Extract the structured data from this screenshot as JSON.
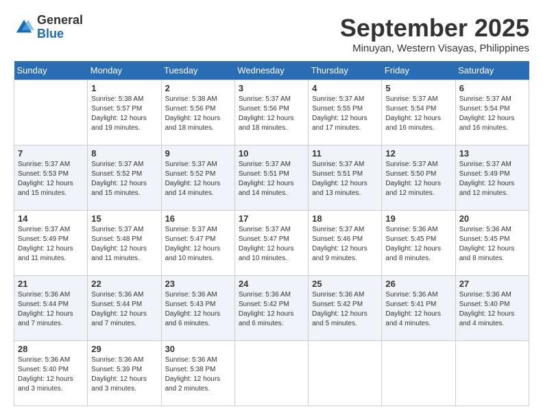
{
  "logo": {
    "general": "General",
    "blue": "Blue"
  },
  "title": "September 2025",
  "location": "Minuyan, Western Visayas, Philippines",
  "headers": [
    "Sunday",
    "Monday",
    "Tuesday",
    "Wednesday",
    "Thursday",
    "Friday",
    "Saturday"
  ],
  "weeks": [
    [
      {
        "day": "",
        "info": ""
      },
      {
        "day": "1",
        "info": "Sunrise: 5:38 AM\nSunset: 5:57 PM\nDaylight: 12 hours\nand 19 minutes."
      },
      {
        "day": "2",
        "info": "Sunrise: 5:38 AM\nSunset: 5:56 PM\nDaylight: 12 hours\nand 18 minutes."
      },
      {
        "day": "3",
        "info": "Sunrise: 5:37 AM\nSunset: 5:56 PM\nDaylight: 12 hours\nand 18 minutes."
      },
      {
        "day": "4",
        "info": "Sunrise: 5:37 AM\nSunset: 5:55 PM\nDaylight: 12 hours\nand 17 minutes."
      },
      {
        "day": "5",
        "info": "Sunrise: 5:37 AM\nSunset: 5:54 PM\nDaylight: 12 hours\nand 16 minutes."
      },
      {
        "day": "6",
        "info": "Sunrise: 5:37 AM\nSunset: 5:54 PM\nDaylight: 12 hours\nand 16 minutes."
      }
    ],
    [
      {
        "day": "7",
        "info": "Sunrise: 5:37 AM\nSunset: 5:53 PM\nDaylight: 12 hours\nand 15 minutes."
      },
      {
        "day": "8",
        "info": "Sunrise: 5:37 AM\nSunset: 5:52 PM\nDaylight: 12 hours\nand 15 minutes."
      },
      {
        "day": "9",
        "info": "Sunrise: 5:37 AM\nSunset: 5:52 PM\nDaylight: 12 hours\nand 14 minutes."
      },
      {
        "day": "10",
        "info": "Sunrise: 5:37 AM\nSunset: 5:51 PM\nDaylight: 12 hours\nand 14 minutes."
      },
      {
        "day": "11",
        "info": "Sunrise: 5:37 AM\nSunset: 5:51 PM\nDaylight: 12 hours\nand 13 minutes."
      },
      {
        "day": "12",
        "info": "Sunrise: 5:37 AM\nSunset: 5:50 PM\nDaylight: 12 hours\nand 12 minutes."
      },
      {
        "day": "13",
        "info": "Sunrise: 5:37 AM\nSunset: 5:49 PM\nDaylight: 12 hours\nand 12 minutes."
      }
    ],
    [
      {
        "day": "14",
        "info": "Sunrise: 5:37 AM\nSunset: 5:49 PM\nDaylight: 12 hours\nand 11 minutes."
      },
      {
        "day": "15",
        "info": "Sunrise: 5:37 AM\nSunset: 5:48 PM\nDaylight: 12 hours\nand 11 minutes."
      },
      {
        "day": "16",
        "info": "Sunrise: 5:37 AM\nSunset: 5:47 PM\nDaylight: 12 hours\nand 10 minutes."
      },
      {
        "day": "17",
        "info": "Sunrise: 5:37 AM\nSunset: 5:47 PM\nDaylight: 12 hours\nand 10 minutes."
      },
      {
        "day": "18",
        "info": "Sunrise: 5:37 AM\nSunset: 5:46 PM\nDaylight: 12 hours\nand 9 minutes."
      },
      {
        "day": "19",
        "info": "Sunrise: 5:36 AM\nSunset: 5:45 PM\nDaylight: 12 hours\nand 8 minutes."
      },
      {
        "day": "20",
        "info": "Sunrise: 5:36 AM\nSunset: 5:45 PM\nDaylight: 12 hours\nand 8 minutes."
      }
    ],
    [
      {
        "day": "21",
        "info": "Sunrise: 5:36 AM\nSunset: 5:44 PM\nDaylight: 12 hours\nand 7 minutes."
      },
      {
        "day": "22",
        "info": "Sunrise: 5:36 AM\nSunset: 5:44 PM\nDaylight: 12 hours\nand 7 minutes."
      },
      {
        "day": "23",
        "info": "Sunrise: 5:36 AM\nSunset: 5:43 PM\nDaylight: 12 hours\nand 6 minutes."
      },
      {
        "day": "24",
        "info": "Sunrise: 5:36 AM\nSunset: 5:42 PM\nDaylight: 12 hours\nand 6 minutes."
      },
      {
        "day": "25",
        "info": "Sunrise: 5:36 AM\nSunset: 5:42 PM\nDaylight: 12 hours\nand 5 minutes."
      },
      {
        "day": "26",
        "info": "Sunrise: 5:36 AM\nSunset: 5:41 PM\nDaylight: 12 hours\nand 4 minutes."
      },
      {
        "day": "27",
        "info": "Sunrise: 5:36 AM\nSunset: 5:40 PM\nDaylight: 12 hours\nand 4 minutes."
      }
    ],
    [
      {
        "day": "28",
        "info": "Sunrise: 5:36 AM\nSunset: 5:40 PM\nDaylight: 12 hours\nand 3 minutes."
      },
      {
        "day": "29",
        "info": "Sunrise: 5:36 AM\nSunset: 5:39 PM\nDaylight: 12 hours\nand 3 minutes."
      },
      {
        "day": "30",
        "info": "Sunrise: 5:36 AM\nSunset: 5:38 PM\nDaylight: 12 hours\nand 2 minutes."
      },
      {
        "day": "",
        "info": ""
      },
      {
        "day": "",
        "info": ""
      },
      {
        "day": "",
        "info": ""
      },
      {
        "day": "",
        "info": ""
      }
    ]
  ]
}
